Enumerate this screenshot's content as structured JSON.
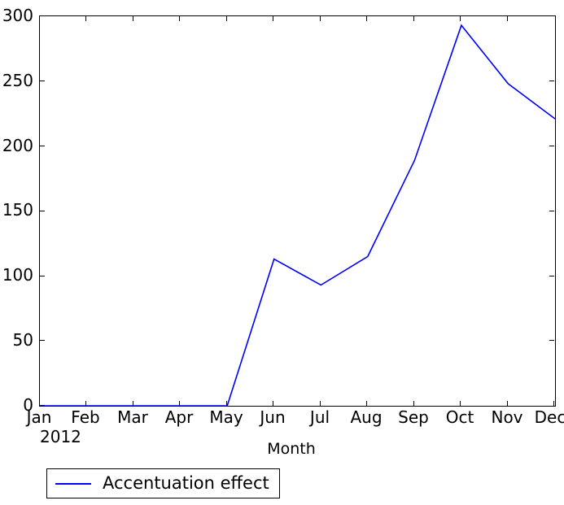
{
  "chart_data": {
    "type": "line",
    "title": "",
    "subtitle": "",
    "xlabel": "Month",
    "ylabel": "",
    "categories": [
      "Jan",
      "Feb",
      "Mar",
      "Apr",
      "May",
      "Jun",
      "Jul",
      "Aug",
      "Sep",
      "Oct",
      "Nov",
      "Dec"
    ],
    "x_year_label": "2012",
    "series": [
      {
        "name": "Accentuation effect",
        "color": "#0000ff",
        "values": [
          0,
          0,
          0,
          0,
          0,
          113,
          93,
          115,
          189,
          293,
          248,
          221
        ]
      }
    ],
    "ylim": [
      0,
      300
    ],
    "yticks": [
      0,
      50,
      100,
      150,
      200,
      250,
      300
    ],
    "ytick_labels": [
      "0",
      "50",
      "100",
      "150",
      "200",
      "250",
      "300"
    ],
    "xlim": [
      0,
      11
    ],
    "grid": false,
    "legend": {
      "position": "below-axes-left",
      "entries": [
        {
          "label": "Accentuation effect",
          "color": "#0000ff",
          "marker": "line"
        }
      ]
    }
  },
  "figure": {
    "background_color": "#ffffff",
    "axis_color": "#000000",
    "text_color": "#000000"
  }
}
